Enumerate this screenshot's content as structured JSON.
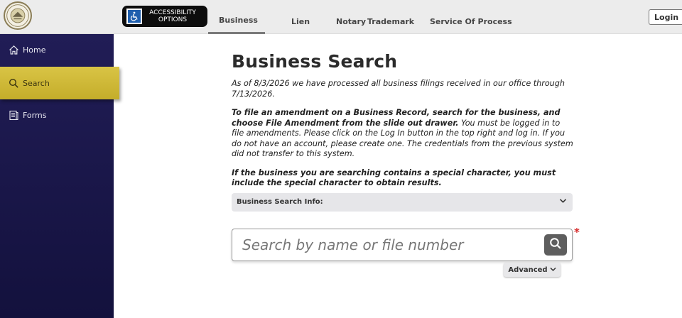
{
  "header": {
    "accessibility_label": "ACCESSIBILITY OPTIONS",
    "tabs": [
      {
        "label": "Business",
        "active": true
      },
      {
        "label": "Lien",
        "active": false
      },
      {
        "label": "Notary",
        "active": false
      },
      {
        "label": "Trademark",
        "active": false
      },
      {
        "label": "Service Of Process",
        "active": false
      }
    ],
    "login_label": "Login"
  },
  "sidebar": {
    "items": [
      {
        "label": "Home",
        "icon": "home-icon",
        "active": false
      },
      {
        "label": "Search",
        "icon": "search-icon",
        "active": true
      },
      {
        "label": "Forms",
        "icon": "forms-icon",
        "active": false
      }
    ]
  },
  "main": {
    "title": "Business Search",
    "processed_notice": "As of 8/3/2026 we have processed all business filings received in our office through 7/13/2026.",
    "amendment_bold": "To file an amendment on a Business Record, search for the business, and choose File Amendment from the slide out drawer.",
    "amendment_rest": " You must be logged in to file amendments. Please click on the Log In button in the top right and log in. If you do not have an account, please create one. The credentials from the previous system did not transfer to this system.",
    "special_char_notice": "If the business you are searching contains a special character, you must include the special character to obtain results.",
    "info_bar_label": "Business Search Info:",
    "search": {
      "placeholder": "Search by name or file number",
      "value": "",
      "required_marker": "*"
    },
    "advanced_label": "Advanced"
  },
  "colors": {
    "sidebar_top": "#211d56",
    "sidebar_bottom": "#13113d",
    "sidebar_active": "#d9c445",
    "topbar": "#ececec",
    "search_button": "#5e5e5e",
    "required": "#d62828"
  }
}
